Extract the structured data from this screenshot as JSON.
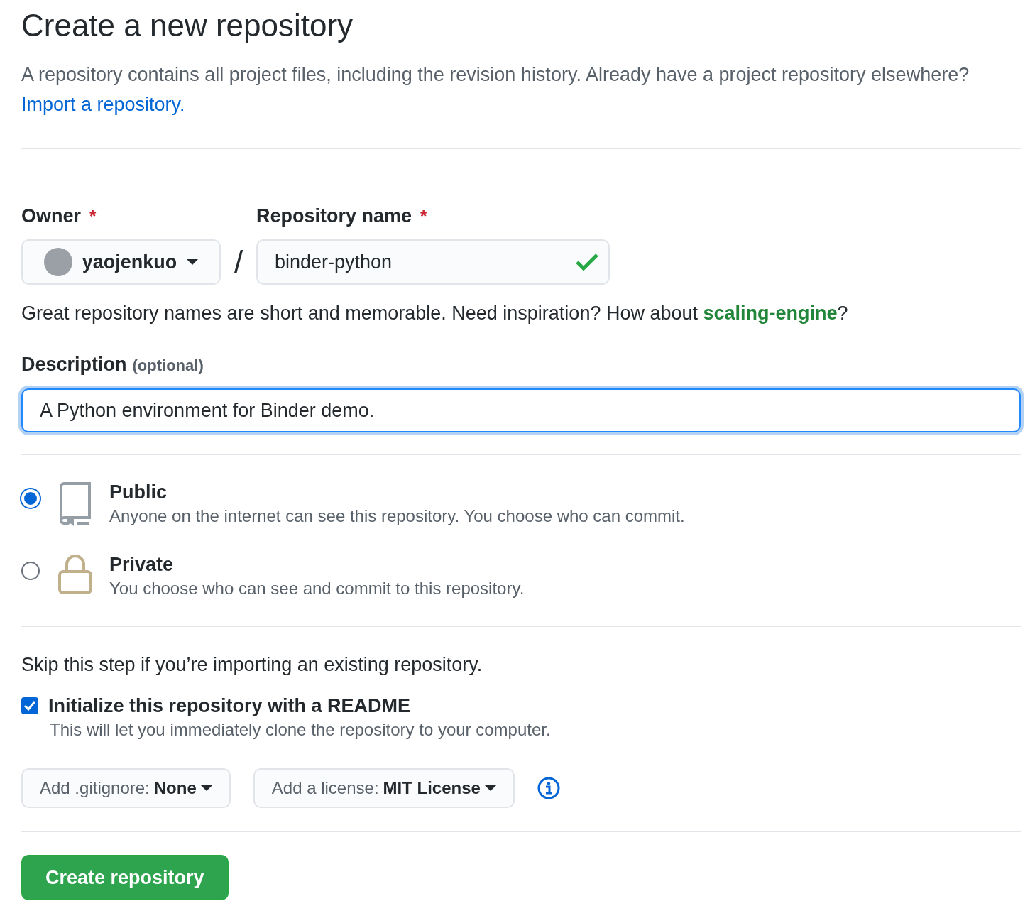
{
  "header": {
    "title": "Create a new repository",
    "intro": "A repository contains all project files, including the revision history. Already have a project repository elsewhere?",
    "import_link": "Import a repository."
  },
  "owner": {
    "label": "Owner",
    "required_mark": "*",
    "value": "yaojenkuo"
  },
  "separator": "/",
  "repository_name": {
    "label": "Repository name",
    "required_mark": "*",
    "value": "binder-python",
    "valid": true
  },
  "name_hint": {
    "text": "Great repository names are short and memorable. Need inspiration? How about",
    "suggestion": "scaling-engine",
    "end": "?"
  },
  "description": {
    "label": "Description",
    "optional": "(optional)",
    "value": "A Python environment for Binder demo.",
    "focused": true
  },
  "visibility": [
    {
      "kind": "public",
      "title": "Public",
      "text": "Anyone on the internet can see this repository. You choose who can commit.",
      "selected": true
    },
    {
      "kind": "private",
      "title": "Private",
      "text": "You choose who can see and commit to this repository.",
      "selected": false
    }
  ],
  "initialize": {
    "note": "Skip this step if you’re importing an existing repository.",
    "readme_label": "Initialize this repository with a README",
    "readme_hint": "This will let you immediately clone the repository to your computer.",
    "checked": true
  },
  "dropdowns": [
    {
      "prefix": "Add .gitignore:",
      "value": "None"
    },
    {
      "prefix": "Add a license:",
      "value": "MIT License"
    }
  ],
  "submit": "Create repository"
}
